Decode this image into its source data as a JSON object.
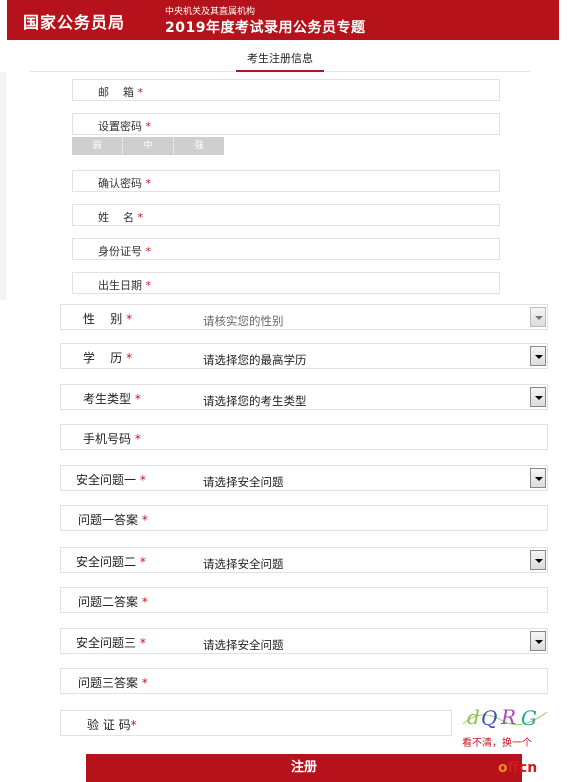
{
  "header": {
    "agency": "国家公务员局",
    "subtitle": "中央机关及其直属机构",
    "title": "2019年度考试录用公务员专题"
  },
  "tab": {
    "label": "考生注册信息"
  },
  "top_fields": [
    {
      "label": "邮    箱",
      "required": "*"
    },
    {
      "label": "设置密码",
      "required": "*"
    },
    {
      "label": "确认密码",
      "required": "*"
    },
    {
      "label": "姓    名",
      "required": "*"
    },
    {
      "label": "身份证号",
      "required": "*"
    },
    {
      "label": "出生日期",
      "required": "*"
    }
  ],
  "strength": [
    "弱",
    "中",
    "强"
  ],
  "rows": [
    {
      "label": "性    别",
      "required": "*",
      "value": "请核实您的性别"
    },
    {
      "label": "学    历",
      "required": "*",
      "value": "请选择您的最高学历"
    },
    {
      "label": "考生类型",
      "required": "*",
      "value": "请选择您的考生类型"
    },
    {
      "label": "手机号码",
      "required": "*",
      "value": ""
    },
    {
      "label": "安全问题一",
      "required": "*",
      "value": "请选择安全问题"
    },
    {
      "label": "问题一答案",
      "required": "*",
      "value": ""
    },
    {
      "label": "安全问题二",
      "required": "*",
      "value": "请选择安全问题"
    },
    {
      "label": "问题二答案",
      "required": "*",
      "value": ""
    },
    {
      "label": "安全问题三",
      "required": "*",
      "value": "请选择安全问题"
    },
    {
      "label": "问题三答案",
      "required": "*",
      "value": ""
    }
  ],
  "captcha": {
    "label": "验 证 码",
    "required": "*",
    "image_text": "dQRG",
    "refresh_link": "看不清，换一个"
  },
  "submit_label": "注册",
  "watermark": {
    "part1": "offcn"
  },
  "colors": {
    "brand": "#b5121b",
    "required_star": "#c8161d"
  }
}
